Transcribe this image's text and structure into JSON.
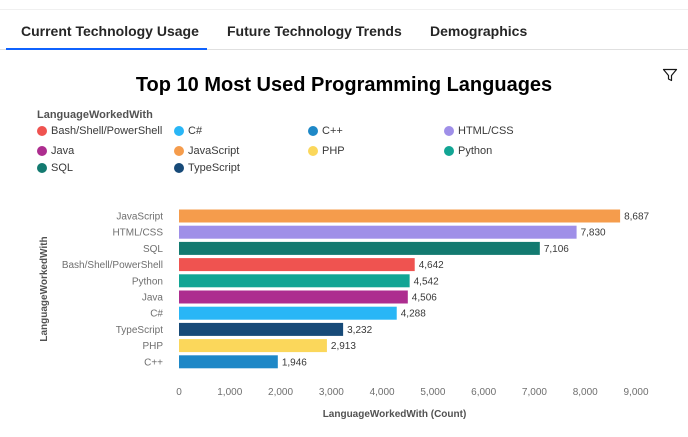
{
  "tabs": [
    {
      "label": "Current Technology Usage",
      "active": true
    },
    {
      "label": "Future Technology Trends",
      "active": false
    },
    {
      "label": "Demographics",
      "active": false
    }
  ],
  "icons": {
    "filter": "filter-icon"
  },
  "chart_data": {
    "type": "bar",
    "orientation": "horizontal",
    "title": "Top 10 Most Used Programming Languages",
    "legend_title": "LanguageWorkedWith",
    "legend_placement": "top-left",
    "ylabel": "LanguageWorkedWith",
    "xlabel": "LanguageWorkedWith (Count)",
    "xlim": [
      0,
      9000
    ],
    "xticks": [
      "0",
      "1,000",
      "2,000",
      "3,000",
      "4,000",
      "5,000",
      "6,000",
      "7,000",
      "8,000",
      "9,000"
    ],
    "grid": false,
    "legend": [
      {
        "name": "Bash/Shell/PowerShell",
        "color": "#ef5350"
      },
      {
        "name": "C#",
        "color": "#29b6f6"
      },
      {
        "name": "C++",
        "color": "#1e88c7"
      },
      {
        "name": "HTML/CSS",
        "color": "#9f8fe8"
      },
      {
        "name": "Java",
        "color": "#ad2d8f"
      },
      {
        "name": "JavaScript",
        "color": "#f59c4c"
      },
      {
        "name": "PHP",
        "color": "#fbd75b"
      },
      {
        "name": "Python",
        "color": "#12a594"
      },
      {
        "name": "SQL",
        "color": "#137a70"
      },
      {
        "name": "TypeScript",
        "color": "#174a78"
      }
    ],
    "bars": [
      {
        "category": "JavaScript",
        "value": 8687,
        "label": "8,687",
        "color": "#f59c4c"
      },
      {
        "category": "HTML/CSS",
        "value": 7830,
        "label": "7,830",
        "color": "#9f8fe8"
      },
      {
        "category": "SQL",
        "value": 7106,
        "label": "7,106",
        "color": "#137a70"
      },
      {
        "category": "Bash/Shell/PowerShell",
        "value": 4642,
        "label": "4,642",
        "color": "#ef5350"
      },
      {
        "category": "Python",
        "value": 4542,
        "label": "4,542",
        "color": "#12a594"
      },
      {
        "category": "Java",
        "value": 4506,
        "label": "4,506",
        "color": "#ad2d8f"
      },
      {
        "category": "C#",
        "value": 4288,
        "label": "4,288",
        "color": "#29b6f6"
      },
      {
        "category": "TypeScript",
        "value": 3232,
        "label": "3,232",
        "color": "#174a78"
      },
      {
        "category": "PHP",
        "value": 2913,
        "label": "2,913",
        "color": "#fbd75b"
      },
      {
        "category": "C++",
        "value": 1946,
        "label": "1,946",
        "color": "#1e88c7"
      }
    ]
  }
}
